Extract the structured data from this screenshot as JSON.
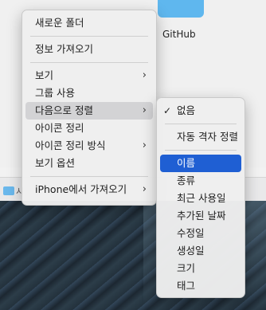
{
  "desktop": {
    "folder_label": "GitHub",
    "finder_bar_text": "시"
  },
  "context_menu": {
    "items": [
      {
        "label": "새로운 폴더"
      },
      {
        "label": "정보 가져오기"
      },
      {
        "label": "보기"
      },
      {
        "label": "그룹 사용"
      },
      {
        "label": "다음으로 정렬"
      },
      {
        "label": "아이콘 정리"
      },
      {
        "label": "아이콘 정리 방식"
      },
      {
        "label": "보기 옵션"
      },
      {
        "label": "iPhone에서 가져오기"
      }
    ],
    "chevron": "›"
  },
  "sort_submenu": {
    "check_mark": "✓",
    "items": [
      {
        "label": "없음"
      },
      {
        "label": "자동 격자 정렬"
      },
      {
        "label": "이름"
      },
      {
        "label": "종류"
      },
      {
        "label": "최근 사용일"
      },
      {
        "label": "추가된 날짜"
      },
      {
        "label": "수정일"
      },
      {
        "label": "생성일"
      },
      {
        "label": "크기"
      },
      {
        "label": "태그"
      }
    ]
  }
}
